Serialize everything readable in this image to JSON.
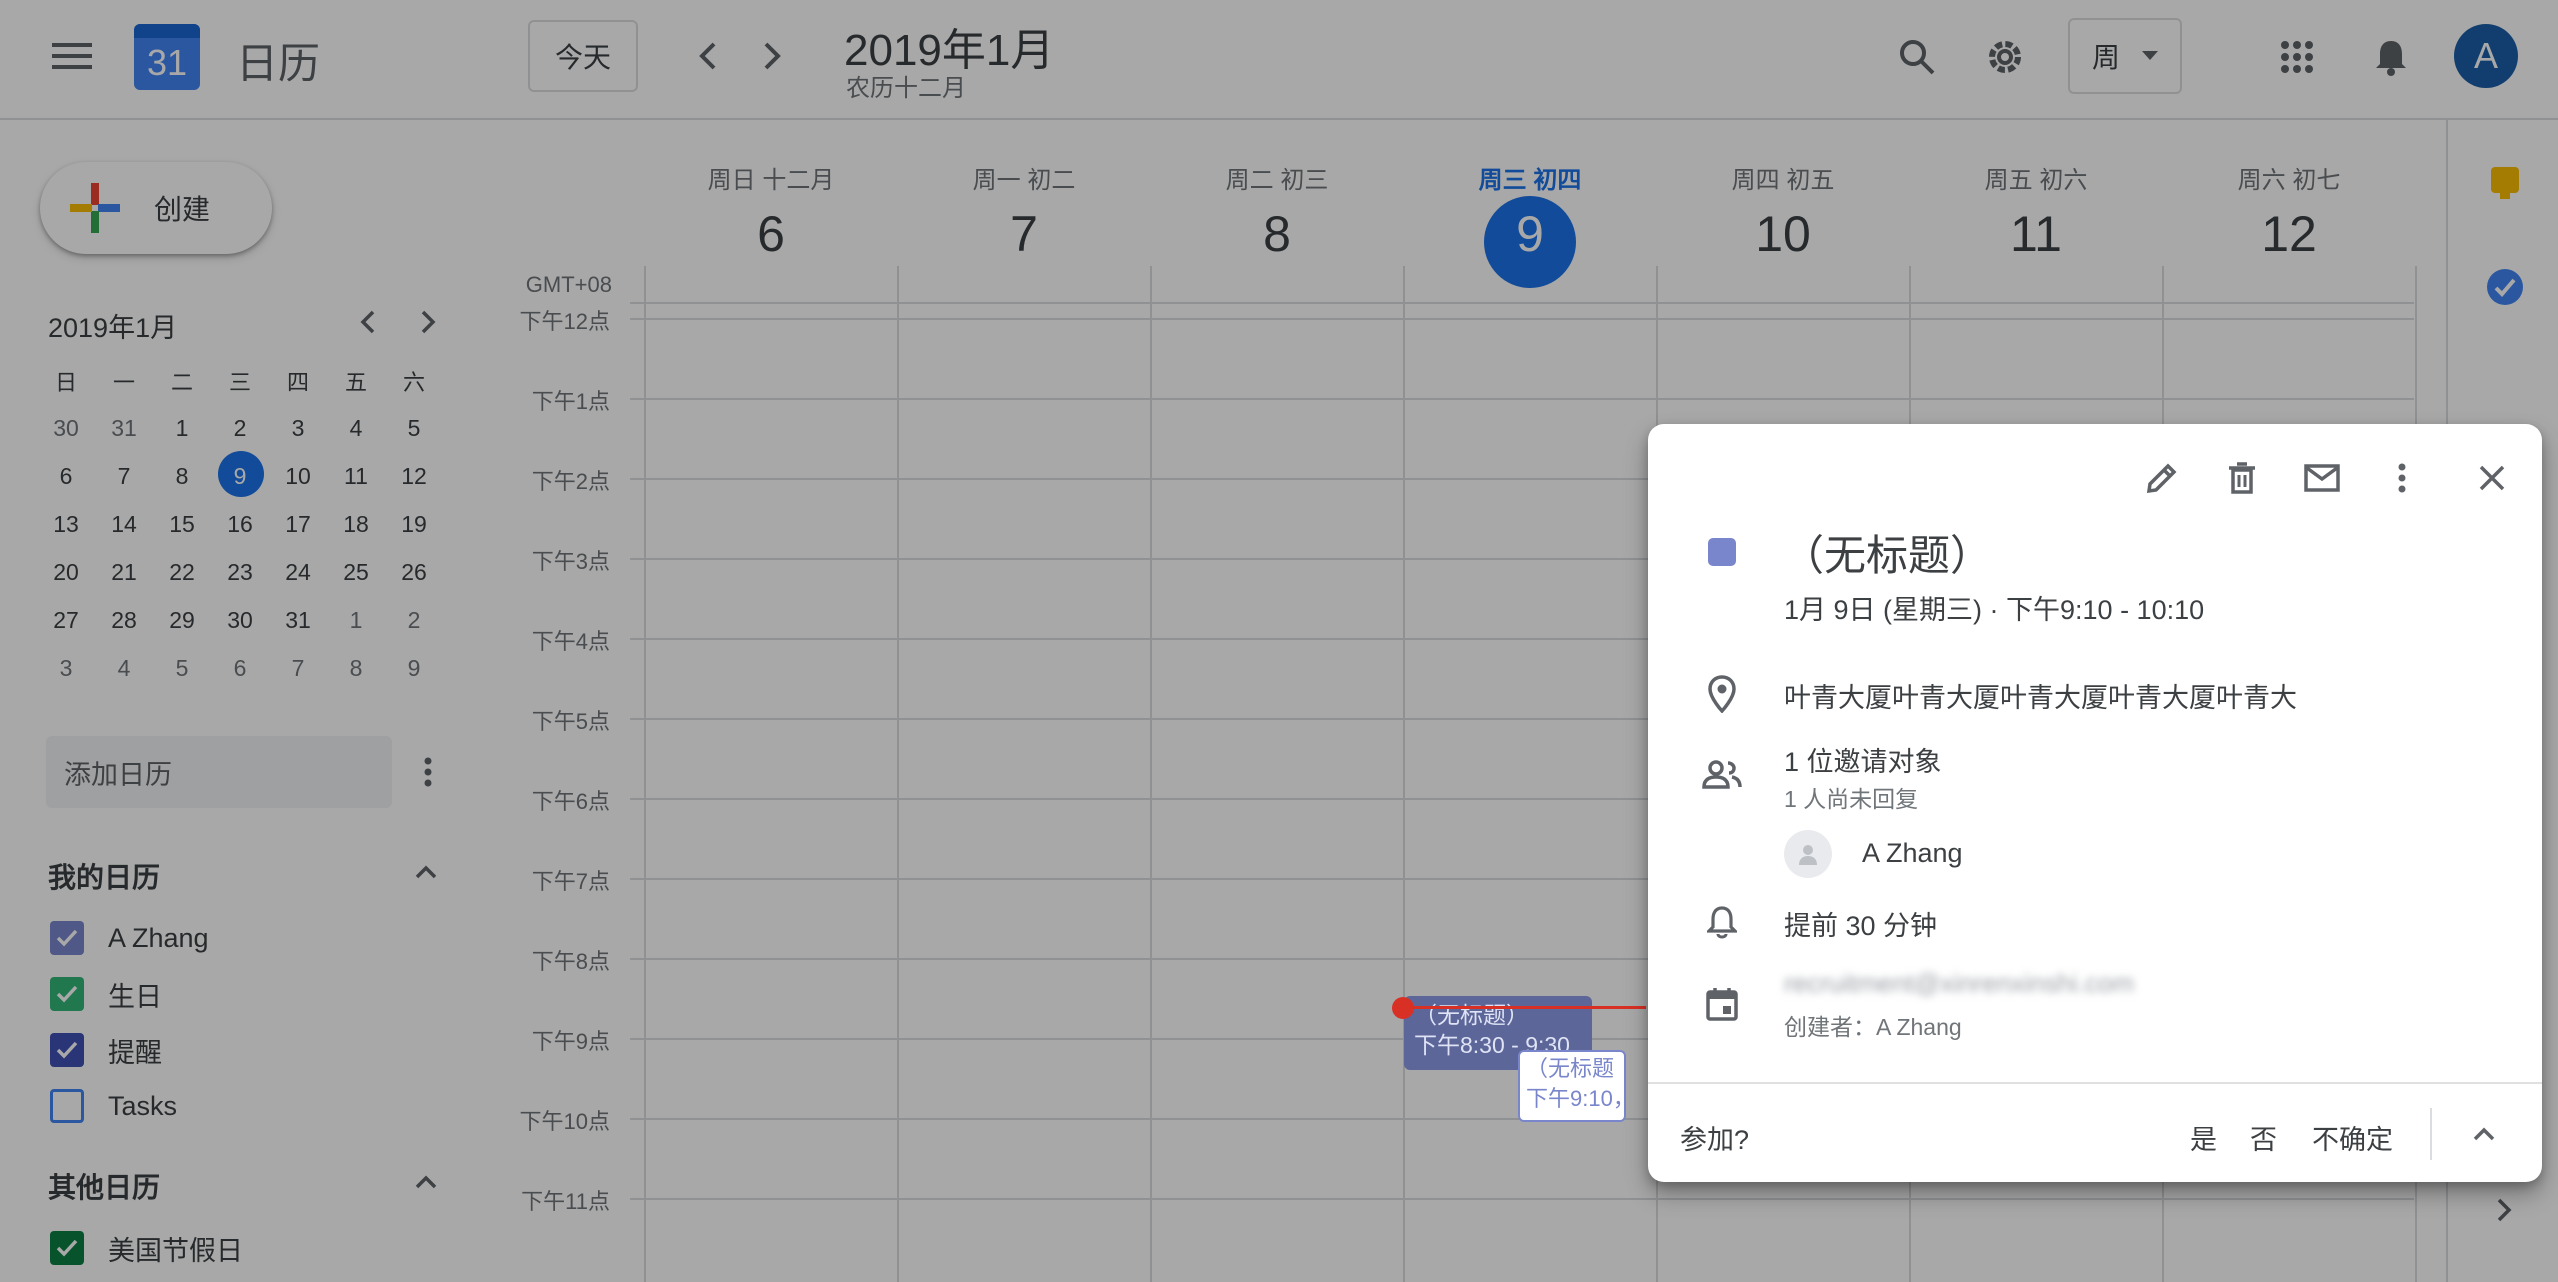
{
  "header": {
    "app_title": "日历",
    "logo_number": "31",
    "today_button": "今天",
    "month_title": "2019年1月",
    "lunar_subtitle": "农历十二月",
    "view_selector": "周",
    "avatar_letter": "A"
  },
  "sidebar": {
    "create_label": "创建",
    "mini_calendar": {
      "title": "2019年1月",
      "weekday_headers": [
        "日",
        "一",
        "二",
        "三",
        "四",
        "五",
        "六"
      ],
      "weeks": [
        [
          "30",
          "31",
          "1",
          "2",
          "3",
          "4",
          "5"
        ],
        [
          "6",
          "7",
          "8",
          "9",
          "10",
          "11",
          "12"
        ],
        [
          "13",
          "14",
          "15",
          "16",
          "17",
          "18",
          "19"
        ],
        [
          "20",
          "21",
          "22",
          "23",
          "24",
          "25",
          "26"
        ],
        [
          "27",
          "28",
          "29",
          "30",
          "31",
          "1",
          "2"
        ],
        [
          "3",
          "4",
          "5",
          "6",
          "7",
          "8",
          "9"
        ]
      ],
      "selected_day": "9"
    },
    "add_calendar_placeholder": "添加日历",
    "my_calendars_title": "我的日历",
    "my_calendars": [
      {
        "name": "A Zhang",
        "color": "#7986cb",
        "checked": true
      },
      {
        "name": "生日",
        "color": "#33b679",
        "checked": true
      },
      {
        "name": "提醒",
        "color": "#3f51b5",
        "checked": true
      },
      {
        "name": "Tasks",
        "color": "#4285f4",
        "checked": false
      }
    ],
    "other_calendars_title": "其他日历",
    "other_calendars": [
      {
        "name": "美国节假日",
        "color": "#0b8043",
        "checked": true
      }
    ]
  },
  "week": {
    "timezone": "GMT+08",
    "days": [
      {
        "name": "周日 十二月",
        "date": "6"
      },
      {
        "name": "周一 初二",
        "date": "7"
      },
      {
        "name": "周二 初三",
        "date": "8"
      },
      {
        "name": "周三 初四",
        "date": "9",
        "today": true
      },
      {
        "name": "周四 初五",
        "date": "10"
      },
      {
        "name": "周五 初六",
        "date": "11"
      },
      {
        "name": "周六 初七",
        "date": "12"
      }
    ],
    "hours": [
      "下午12点",
      "下午1点",
      "下午2点",
      "下午3点",
      "下午4点",
      "下午5点",
      "下午6点",
      "下午7点",
      "下午8点",
      "下午9点",
      "下午10点",
      "下午11点"
    ],
    "events": [
      {
        "title": "（无标题）",
        "time": "下午8:30 - 9:30"
      },
      {
        "title": "（无标题",
        "time": "下午9:10，"
      }
    ]
  },
  "popup": {
    "title": "（无标题）",
    "color": "#7986cb",
    "date_time": "1月 9日 (星期三) · 下午9:10 - 10:10",
    "location": "叶青大厦叶青大厦叶青大厦叶青大厦叶青大",
    "guests_summary": "1 位邀请对象",
    "guests_pending": "1 人尚未回复",
    "guest_name": "A Zhang",
    "reminder": "提前 30 分钟",
    "calendar_email": "recruitment@xinrenxinshi.com",
    "creator": "创建者：A Zhang",
    "rsvp_question": "参加?",
    "rsvp_yes": "是",
    "rsvp_no": "否",
    "rsvp_maybe": "不确定"
  }
}
